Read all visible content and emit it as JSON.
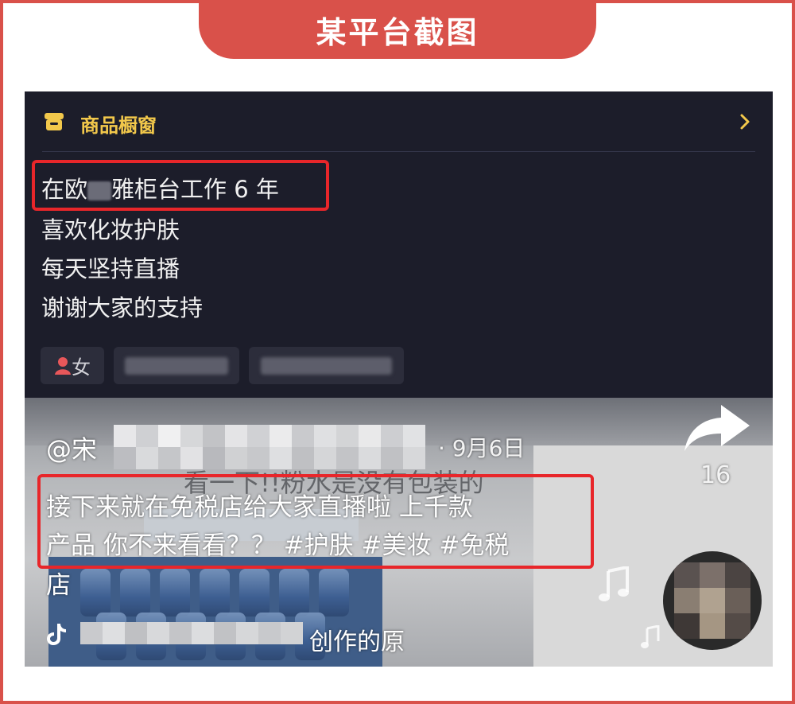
{
  "header": {
    "title": "某平台截图"
  },
  "panel": {
    "showcase_label": "商品橱窗",
    "bio": {
      "line1_prefix": "在欧",
      "line1_suffix": "雅柜台工作 6 年",
      "line2": "喜欢化妆护肤",
      "line3": "每天坚持直播",
      "line4": "谢谢大家的支持"
    },
    "gender_chip": "女",
    "icons": {
      "showcase": "shop-icon",
      "gender": "person-icon",
      "more": "chevron-right-icon"
    }
  },
  "video": {
    "author_prefix": "@宋",
    "date": "· 9月6日",
    "background_caption": "看一下!!粉水是没有包装的",
    "caption_line1": "接下来就在免税店给大家直播啦 上千款",
    "caption_line2": "产品 你不来看看？？ #护肤 #美妆 #免税",
    "caption_line3": "店",
    "share_count": "16",
    "music_text": "创作的原",
    "icons": {
      "share": "share-arrow-icon",
      "music": "music-note-icon",
      "platform": "tiktok-icon"
    }
  },
  "colors": {
    "accent_red": "#d9514a",
    "highlight_red": "#e8262a",
    "panel_bg": "#1c1d2a",
    "showcase_yellow": "#f2c84b"
  }
}
